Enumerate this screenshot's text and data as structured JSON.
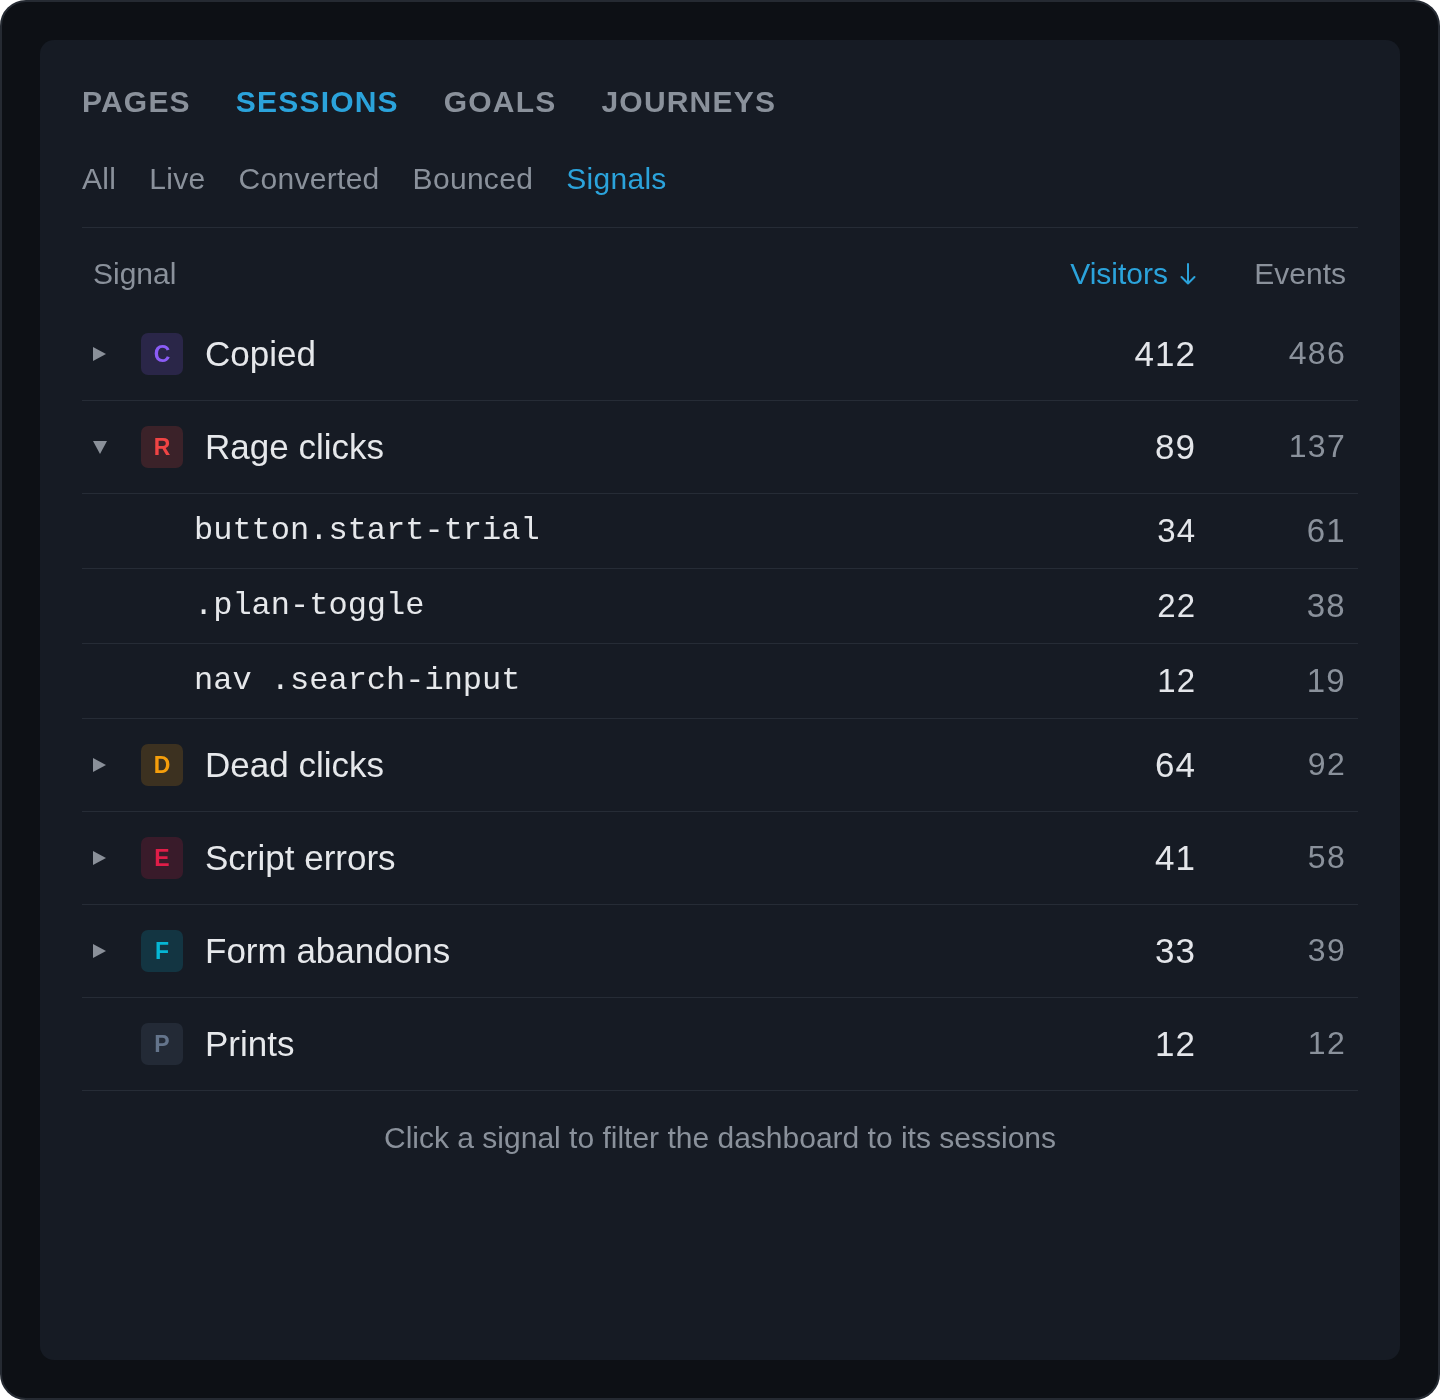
{
  "tabs": [
    {
      "label": "PAGES",
      "selected": false
    },
    {
      "label": "SESSIONS",
      "selected": true
    },
    {
      "label": "GOALS",
      "selected": false
    },
    {
      "label": "JOURNEYS",
      "selected": false
    }
  ],
  "subtabs": [
    {
      "label": "All",
      "selected": false
    },
    {
      "label": "Live",
      "selected": false
    },
    {
      "label": "Converted",
      "selected": false
    },
    {
      "label": "Bounced",
      "selected": false
    },
    {
      "label": "Signals",
      "selected": true
    }
  ],
  "table": {
    "columns": [
      {
        "label": "Signal",
        "sorted": false
      },
      {
        "label": "Visitors",
        "sorted": true
      },
      {
        "label": "Events",
        "sorted": false
      }
    ],
    "rows": [
      {
        "badge": "C",
        "color": "#8b5cf6",
        "name": "Copied",
        "visitors": "412",
        "events": "486",
        "expandable": true,
        "expanded": false
      },
      {
        "badge": "R",
        "color": "#ef4444",
        "name": "Rage clicks",
        "visitors": "89",
        "events": "137",
        "expandable": true,
        "expanded": true,
        "children": [
          {
            "selector": "button.start-trial",
            "visitors": "34",
            "events": "61"
          },
          {
            "selector": ".plan-toggle",
            "visitors": "22",
            "events": "38"
          },
          {
            "selector": "nav .search-input",
            "visitors": "12",
            "events": "19"
          }
        ]
      },
      {
        "badge": "D",
        "color": "#f59e0b",
        "name": "Dead clicks",
        "visitors": "64",
        "events": "92",
        "expandable": true,
        "expanded": false
      },
      {
        "badge": "E",
        "color": "#e11d48",
        "name": "Script errors",
        "visitors": "41",
        "events": "58",
        "expandable": true,
        "expanded": false
      },
      {
        "badge": "F",
        "color": "#06b6d4",
        "name": "Form abandons",
        "visitors": "33",
        "events": "39",
        "expandable": true,
        "expanded": false
      },
      {
        "badge": "P",
        "color": "#64748b",
        "name": "Prints",
        "visitors": "12",
        "events": "12",
        "expandable": false,
        "expanded": false
      }
    ]
  },
  "footer": "Click a signal to filter the dashboard to its sessions"
}
